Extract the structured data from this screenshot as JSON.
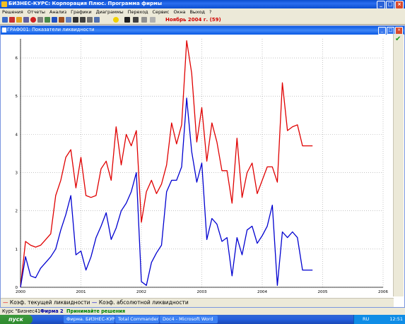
{
  "app": {
    "title": "БИЗНЕС-КУРС: Корпорация Плюс. Программа фирмы",
    "window_controls": [
      "_",
      "□",
      "×"
    ]
  },
  "menu": [
    "Решения",
    "Отчеты",
    "Анализ",
    "Графики",
    "Диаграммы",
    "Переход",
    "Сервис",
    "Окна",
    "Выход",
    "?"
  ],
  "toolbar": {
    "icons": [
      "report-icon",
      "analysis-icon",
      "chart-icon",
      "settings-icon",
      "stop-icon",
      "tools-icon",
      "print-icon",
      "help-icon",
      "calc-icon",
      "info-icon",
      "next-icon",
      "pause-icon",
      "back-icon",
      "forward-icon",
      "warning-icon",
      "first-icon",
      "prev-icon",
      "next-page-icon",
      "last-icon"
    ],
    "period": "Ноябрь 2004 г. (59)"
  },
  "graph_window": {
    "title": "ГРАФ001: Показатели ликвидности",
    "legend": [
      {
        "marker": "—",
        "label": "Коэф. текущей ликвидности",
        "color": "#e00000"
      },
      {
        "marker": "—",
        "label": "Коэф. абсолютной ликвидности",
        "color": "#0000d0"
      }
    ]
  },
  "status": {
    "course": "Курс \"Бизнес41\"",
    "firm": "Фирма 2",
    "action": "Принимайте решения"
  },
  "taskbar": {
    "start": "пуск",
    "tasks": [
      "Фирма. БИЗНЕС-КУРС",
      "Total Commander 7.0...",
      "Doc4 - Microsoft Word"
    ],
    "lang": "RU",
    "clock": "12:51"
  },
  "chart_data": {
    "type": "line",
    "title": "",
    "xlabel": "",
    "ylabel": "",
    "xlim": [
      2000,
      2006
    ],
    "ylim": [
      0,
      6.5
    ],
    "x_ticks": [
      "2000",
      "2001",
      "2002",
      "2003",
      "2004",
      "2005",
      "2006"
    ],
    "y_ticks": [
      "0",
      "1",
      "2",
      "3",
      "4",
      "5",
      "6"
    ],
    "grid": true,
    "legend_position": "bottom",
    "x": [
      2000.0,
      2000.083,
      2000.167,
      2000.25,
      2000.333,
      2000.417,
      2000.5,
      2000.583,
      2000.667,
      2000.75,
      2000.833,
      2000.917,
      2001.0,
      2001.083,
      2001.167,
      2001.25,
      2001.333,
      2001.417,
      2001.5,
      2001.583,
      2001.667,
      2001.75,
      2001.833,
      2001.917,
      2002.0,
      2002.083,
      2002.167,
      2002.25,
      2002.333,
      2002.417,
      2002.5,
      2002.583,
      2002.667,
      2002.75,
      2002.833,
      2002.917,
      2003.0,
      2003.083,
      2003.167,
      2003.25,
      2003.333,
      2003.417,
      2003.5,
      2003.583,
      2003.667,
      2003.75,
      2003.833,
      2003.917,
      2004.0,
      2004.083,
      2004.167,
      2004.25,
      2004.333,
      2004.417,
      2004.5,
      2004.583,
      2004.667,
      2004.75,
      2004.833
    ],
    "series": [
      {
        "name": "Коэф. текущей ликвидности",
        "color": "#e00000",
        "values": [
          0.0,
          1.2,
          1.1,
          1.05,
          1.1,
          1.25,
          1.4,
          2.4,
          2.8,
          3.4,
          3.6,
          2.6,
          3.4,
          2.4,
          2.35,
          2.4,
          3.1,
          3.3,
          2.8,
          4.2,
          3.2,
          4.0,
          3.7,
          4.1,
          1.7,
          2.5,
          2.8,
          2.45,
          2.7,
          3.2,
          4.3,
          3.75,
          4.25,
          6.45,
          5.6,
          3.8,
          4.7,
          3.3,
          4.3,
          3.8,
          3.05,
          3.05,
          2.2,
          3.9,
          2.35,
          3.0,
          3.25,
          2.45,
          2.8,
          3.15,
          3.15,
          2.75,
          5.35,
          4.1,
          4.2,
          4.25,
          3.7,
          3.7,
          3.7
        ]
      },
      {
        "name": "Коэф. абсолютной ликвидности",
        "color": "#0000d0",
        "values": [
          0.0,
          0.8,
          0.3,
          0.25,
          0.5,
          0.65,
          0.8,
          1.0,
          1.5,
          1.9,
          2.4,
          0.85,
          0.95,
          0.45,
          0.8,
          1.3,
          1.6,
          1.95,
          1.25,
          1.55,
          2.0,
          2.2,
          2.5,
          3.0,
          0.15,
          0.05,
          0.65,
          0.9,
          1.1,
          2.5,
          2.8,
          2.8,
          3.15,
          4.95,
          3.55,
          2.75,
          3.25,
          1.25,
          1.8,
          1.65,
          1.2,
          1.3,
          0.3,
          1.3,
          0.85,
          1.5,
          1.6,
          1.15,
          1.35,
          1.6,
          2.15,
          0.05,
          1.45,
          1.3,
          1.45,
          1.3,
          0.45,
          0.45,
          0.45
        ]
      }
    ]
  }
}
